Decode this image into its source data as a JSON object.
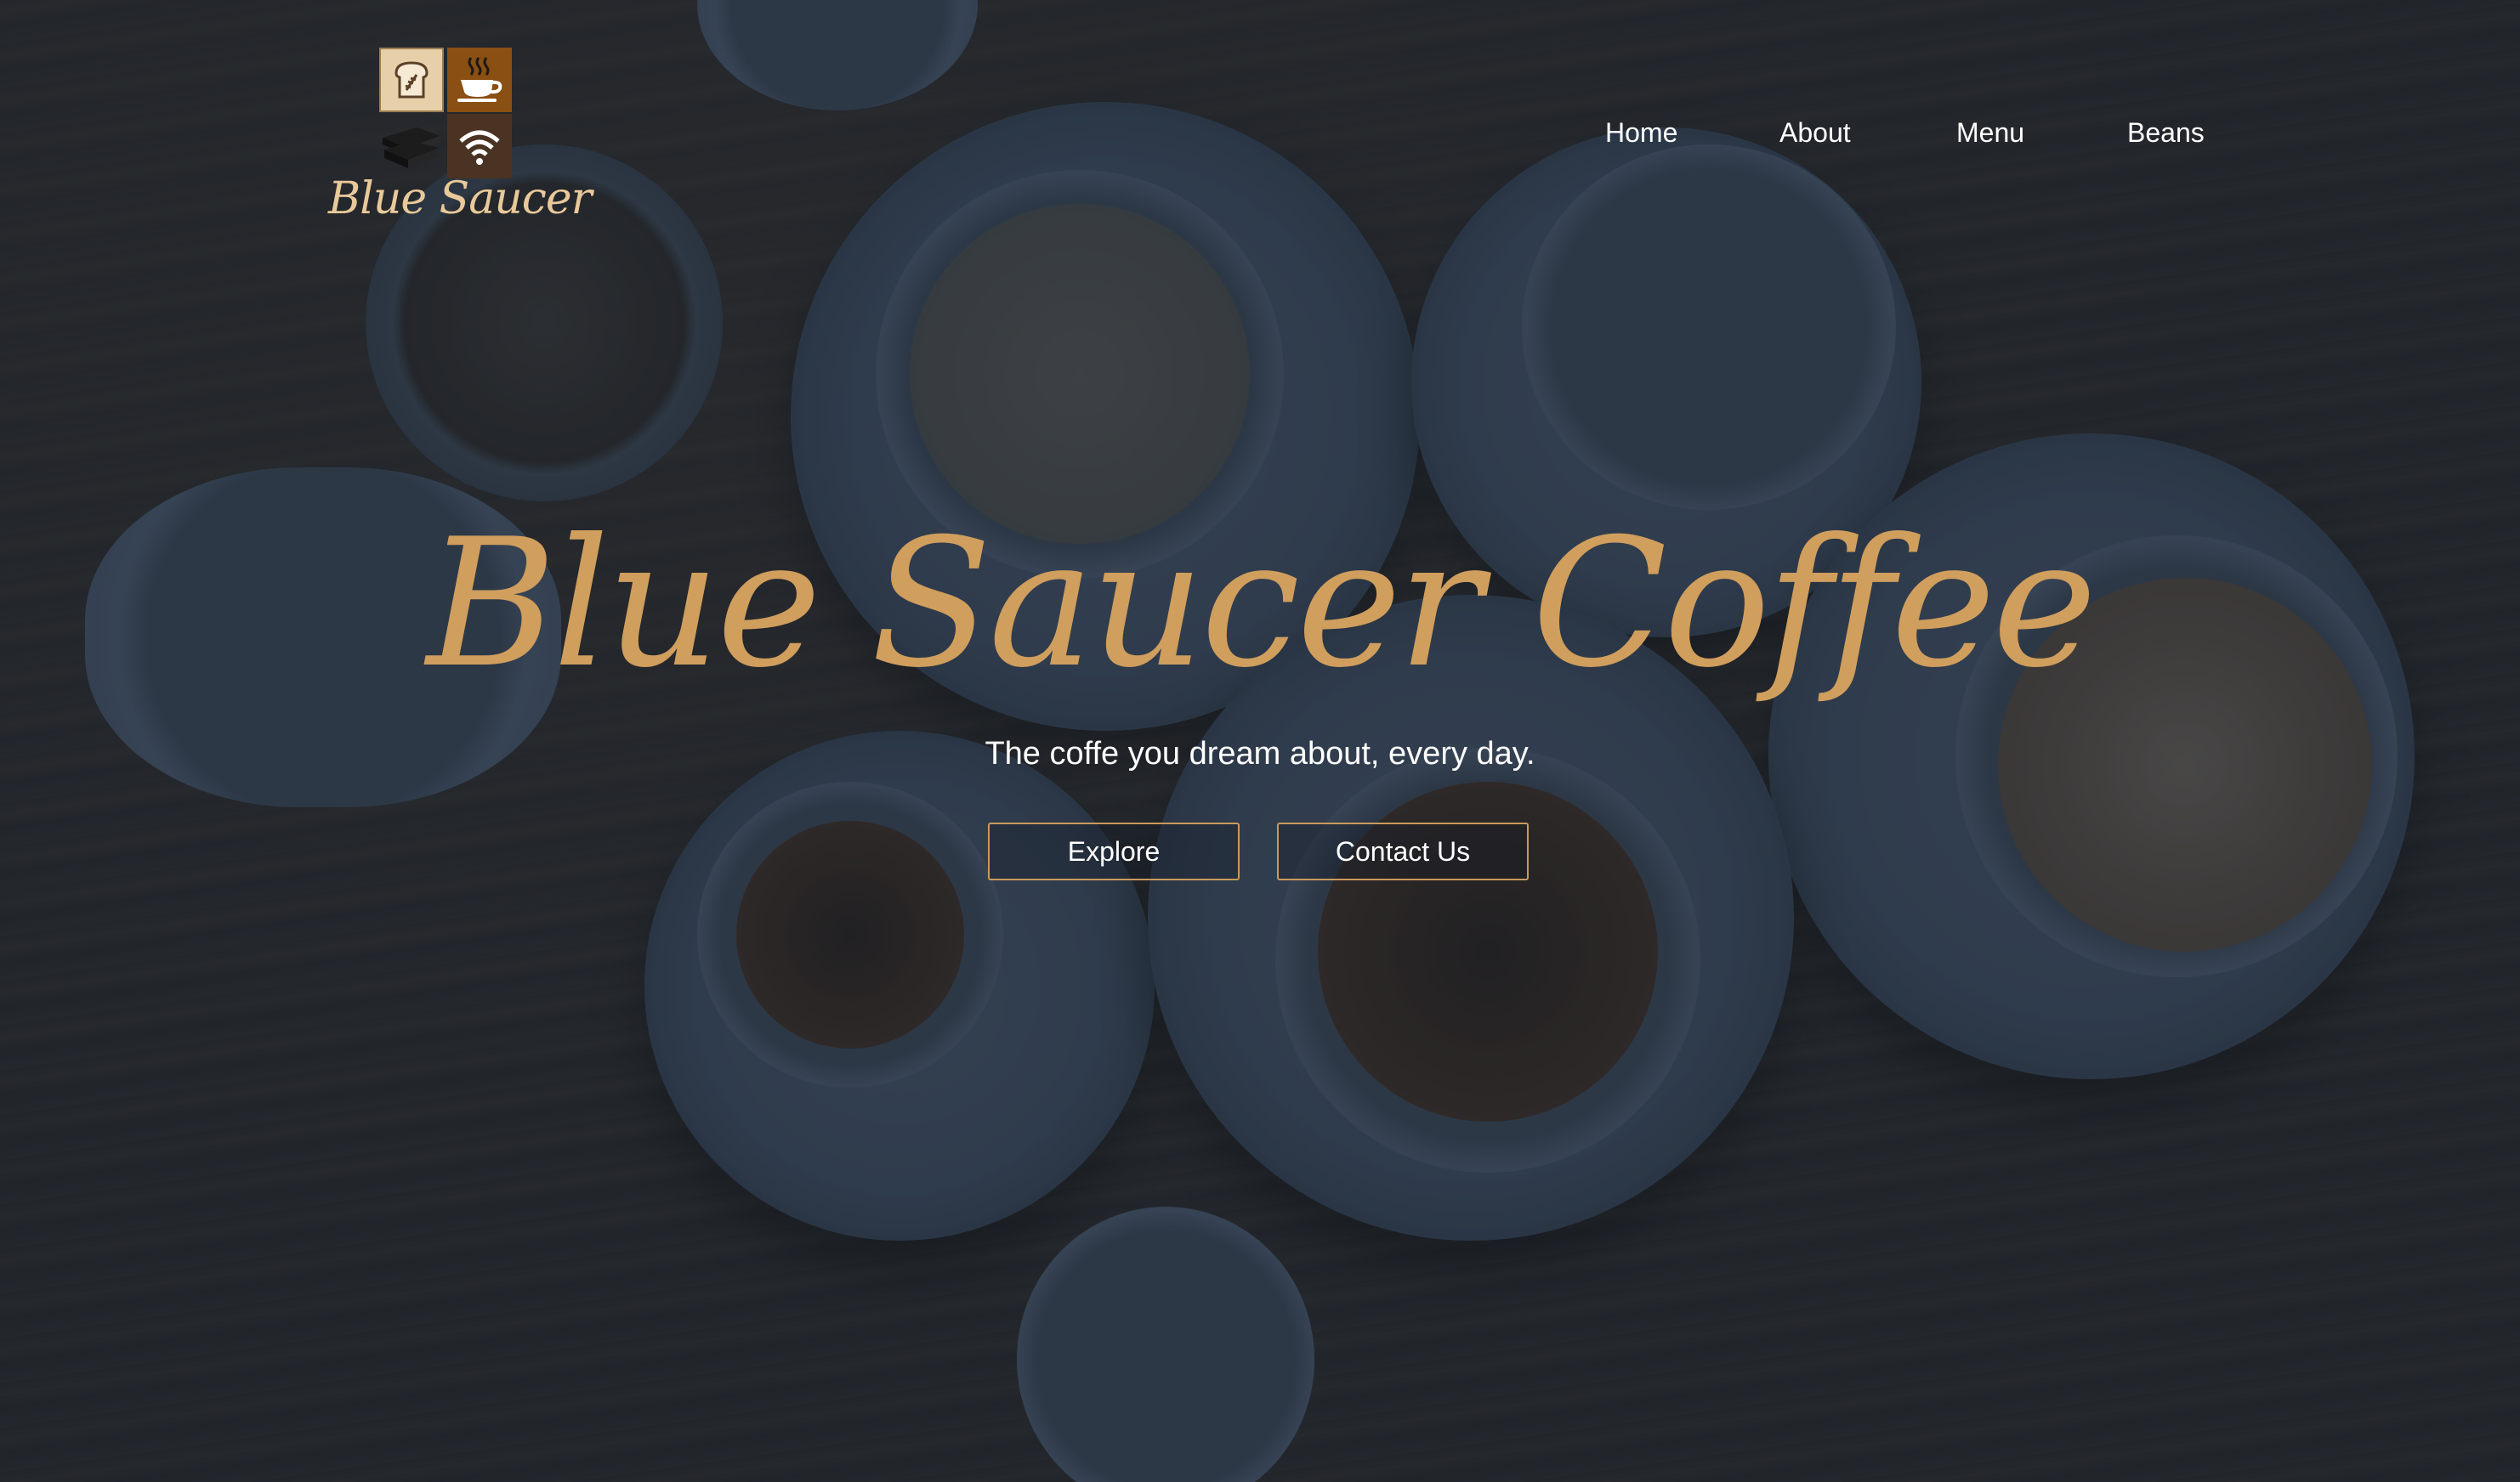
{
  "brand": {
    "logo_text": "Blue Saucer",
    "tiles": [
      "bread-icon",
      "coffee-cup-icon",
      "books-icon",
      "wifi-icon"
    ]
  },
  "nav": {
    "items": [
      {
        "label": "Home"
      },
      {
        "label": "About"
      },
      {
        "label": "Menu"
      },
      {
        "label": "Beans"
      }
    ]
  },
  "hero": {
    "title": "Blue Saucer Coffee",
    "subtitle": "The coffe you dream about, every day.",
    "buttons": {
      "explore": "Explore",
      "contact": "Contact Us"
    }
  },
  "colors": {
    "accent": "#d09e5d",
    "button_border": "#c99a5c",
    "overlay": "#161e2c",
    "text": "#ffffff"
  }
}
